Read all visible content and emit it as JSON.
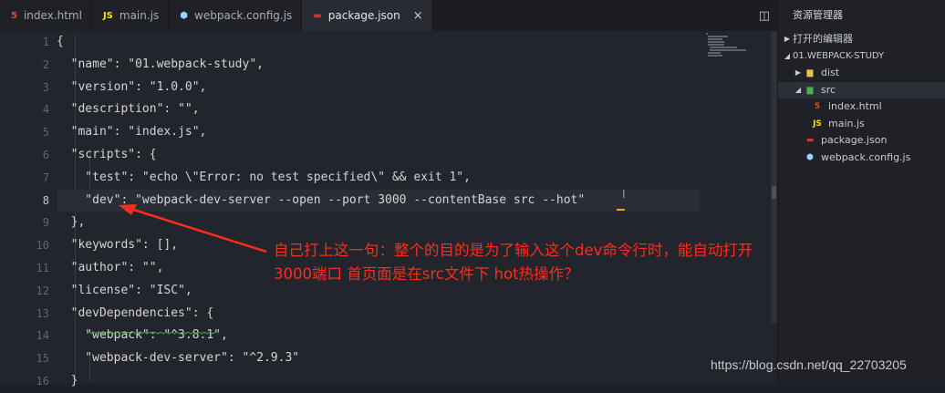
{
  "tabs": [
    {
      "label": "index.html",
      "icon": "html5-icon",
      "icon_text": "5",
      "icon_color": "#e34c26"
    },
    {
      "label": "main.js",
      "icon": "js-icon",
      "icon_text": "JS",
      "icon_color": "#f5de19"
    },
    {
      "label": "webpack.config.js",
      "icon": "webpack-icon",
      "icon_text": "⬢",
      "icon_color": "#8ed6fb"
    },
    {
      "label": "package.json",
      "icon": "json-icon",
      "icon_text": "▬",
      "icon_color": "#cb3837",
      "active": true,
      "close": "×"
    }
  ],
  "tab_actions": {
    "split": "◫",
    "more": "···"
  },
  "explorer": {
    "title": "资源管理器",
    "open_editors": "打开的编辑器",
    "project": "01.WEBPACK-STUDY",
    "items": [
      {
        "label": "dist",
        "type": "folder",
        "depth": 1,
        "twisty": "▶"
      },
      {
        "label": "src",
        "type": "folder-open",
        "depth": 1,
        "twisty": "◢"
      },
      {
        "label": "index.html",
        "type": "html",
        "depth": 2
      },
      {
        "label": "main.js",
        "type": "js",
        "depth": 2
      },
      {
        "label": "package.json",
        "type": "json",
        "depth": 1
      },
      {
        "label": "webpack.config.js",
        "type": "webpack",
        "depth": 1
      }
    ],
    "twisty_collapsed": "▶",
    "twisty_expanded": "◢"
  },
  "code_lines": [
    {
      "n": "1",
      "text": "{"
    },
    {
      "n": "2",
      "text": "  \"name\": \"01.webpack-study\","
    },
    {
      "n": "3",
      "text": "  \"version\": \"1.0.0\","
    },
    {
      "n": "4",
      "text": "  \"description\": \"\","
    },
    {
      "n": "5",
      "text": "  \"main\": \"index.js\","
    },
    {
      "n": "6",
      "text": "  \"scripts\": {"
    },
    {
      "n": "7",
      "text": "    \"test\": \"echo \\\"Error: no test specified\\\" && exit 1\","
    },
    {
      "n": "8",
      "text": "    \"dev\": \"webpack-dev-server --open --port 3000 --contentBase src --hot\""
    },
    {
      "n": "9",
      "text": "  },"
    },
    {
      "n": "10",
      "text": "  \"keywords\": [],"
    },
    {
      "n": "11",
      "text": "  \"author\": \"\","
    },
    {
      "n": "12",
      "text": "  \"license\": \"ISC\","
    },
    {
      "n": "13",
      "text": "  \"devDependencies\": {"
    },
    {
      "n": "14",
      "text": "    \"webpack\": \"^3.8.1\","
    },
    {
      "n": "15",
      "text": "    \"webpack-dev-server\": \"^2.9.3\""
    },
    {
      "n": "16",
      "text": "  }"
    }
  ],
  "current_line": 8,
  "annotation": "自己打上这一句：整个的目的是为了输入这个dev命令行时，能自动打开 3000端口   首页面是在src文件下  hot热操作？",
  "watermark": "https://blog.csdn.net/qq_22703205",
  "colors": {
    "annotation": "#ff2b1c",
    "arrow": "#ff2b1c",
    "squiggle": "#3fae49"
  }
}
